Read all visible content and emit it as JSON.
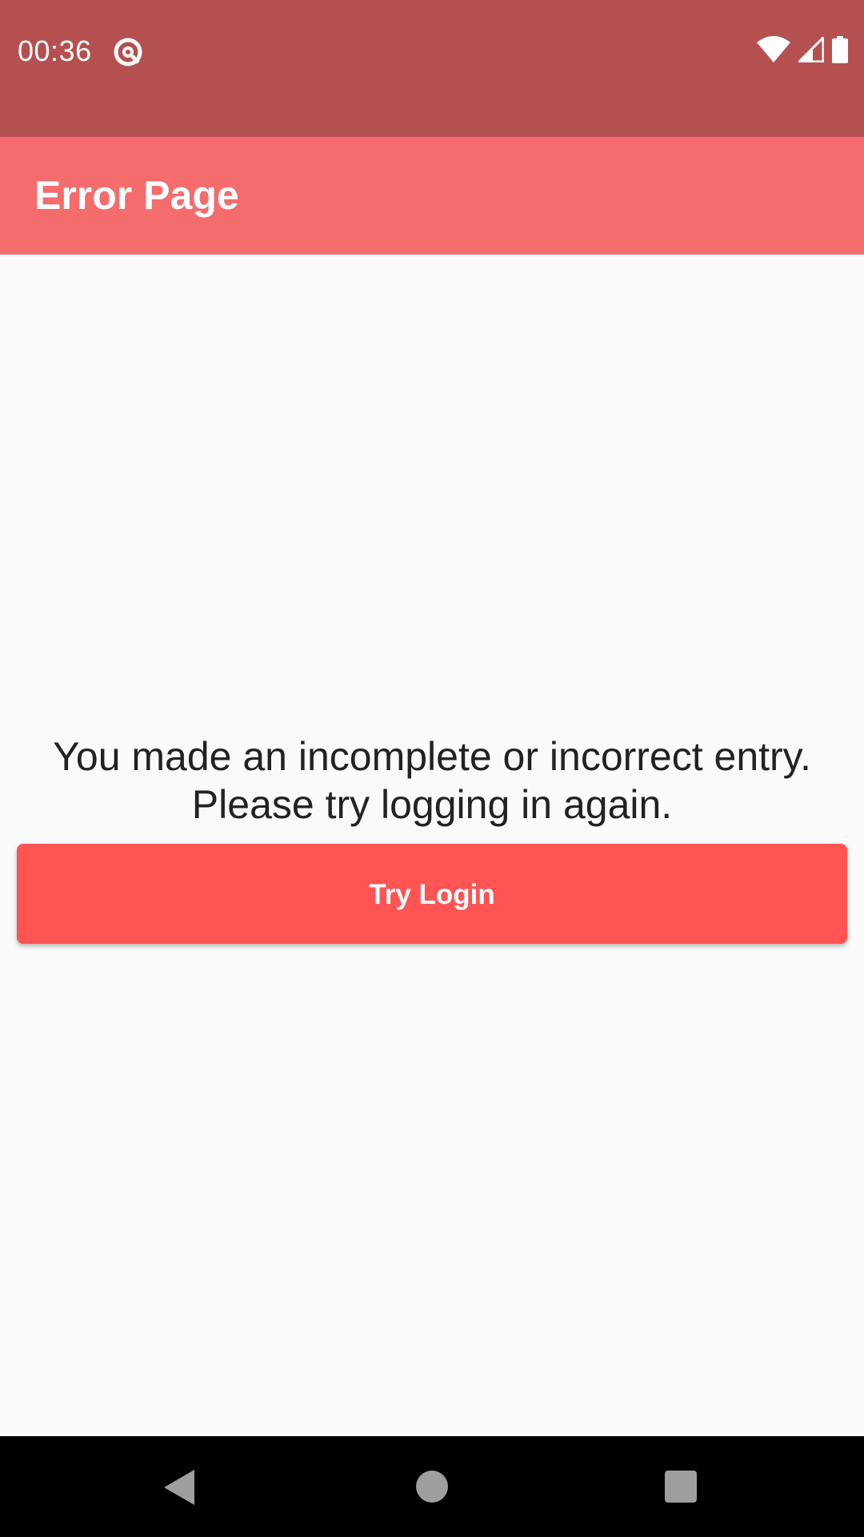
{
  "status_bar": {
    "time": "00:36",
    "app_icon": "at-sign-notification-icon",
    "right_icons": [
      "wifi-icon",
      "cellular-signal-icon",
      "battery-icon"
    ],
    "background_color": "#b55050"
  },
  "app_bar": {
    "title": "Error Page",
    "background_color": "#f46c6c"
  },
  "main": {
    "message_line_1": "You made an incomplete or incorrect entry.",
    "message_line_2": "Please try logging in again.",
    "button_label": "Try Login",
    "button_color": "#fe5454"
  },
  "nav_bar": {
    "icons": [
      "back-icon",
      "home-icon",
      "recents-icon"
    ]
  }
}
